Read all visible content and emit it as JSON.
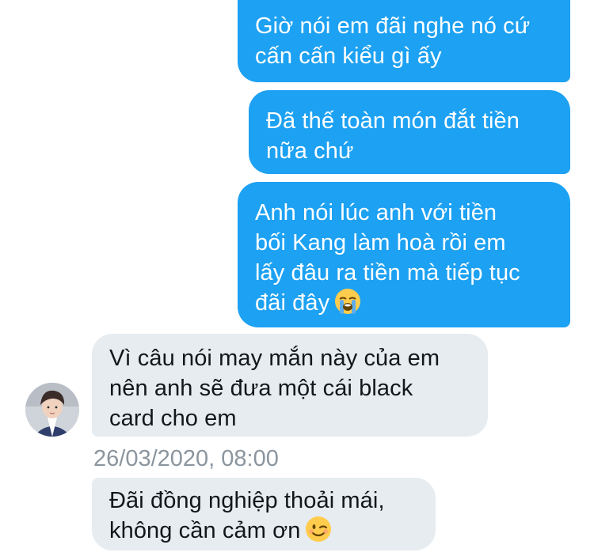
{
  "messages": {
    "m1": "Giờ nói em đãi nghe nó cứ\ncấn cấn kiểu gì ấy",
    "m2": "Đã thế toàn món đắt tiền\nnữa chứ",
    "m3": "Anh nói lúc anh với tiền\nbối Kang làm hoà rồi em\nlấy đâu ra tiền mà tiếp tục\nđãi đây",
    "m4": "Vì câu nói may mắn này của em\nnên anh sẽ đưa một cái black\ncard cho em",
    "m5": "Đãi đồng nghiệp thoải mái,\nkhông cần cảm ơn"
  },
  "timestamp": "26/03/2020, 08:00",
  "icons": {
    "m3_emoji": "loudly-crying-face-emoji",
    "m5_emoji": "winking-face-emoji"
  },
  "colors": {
    "outgoing_bubble": "#1da1f2",
    "incoming_bubble": "#e6ecf0",
    "timestamp": "#8b959e"
  }
}
